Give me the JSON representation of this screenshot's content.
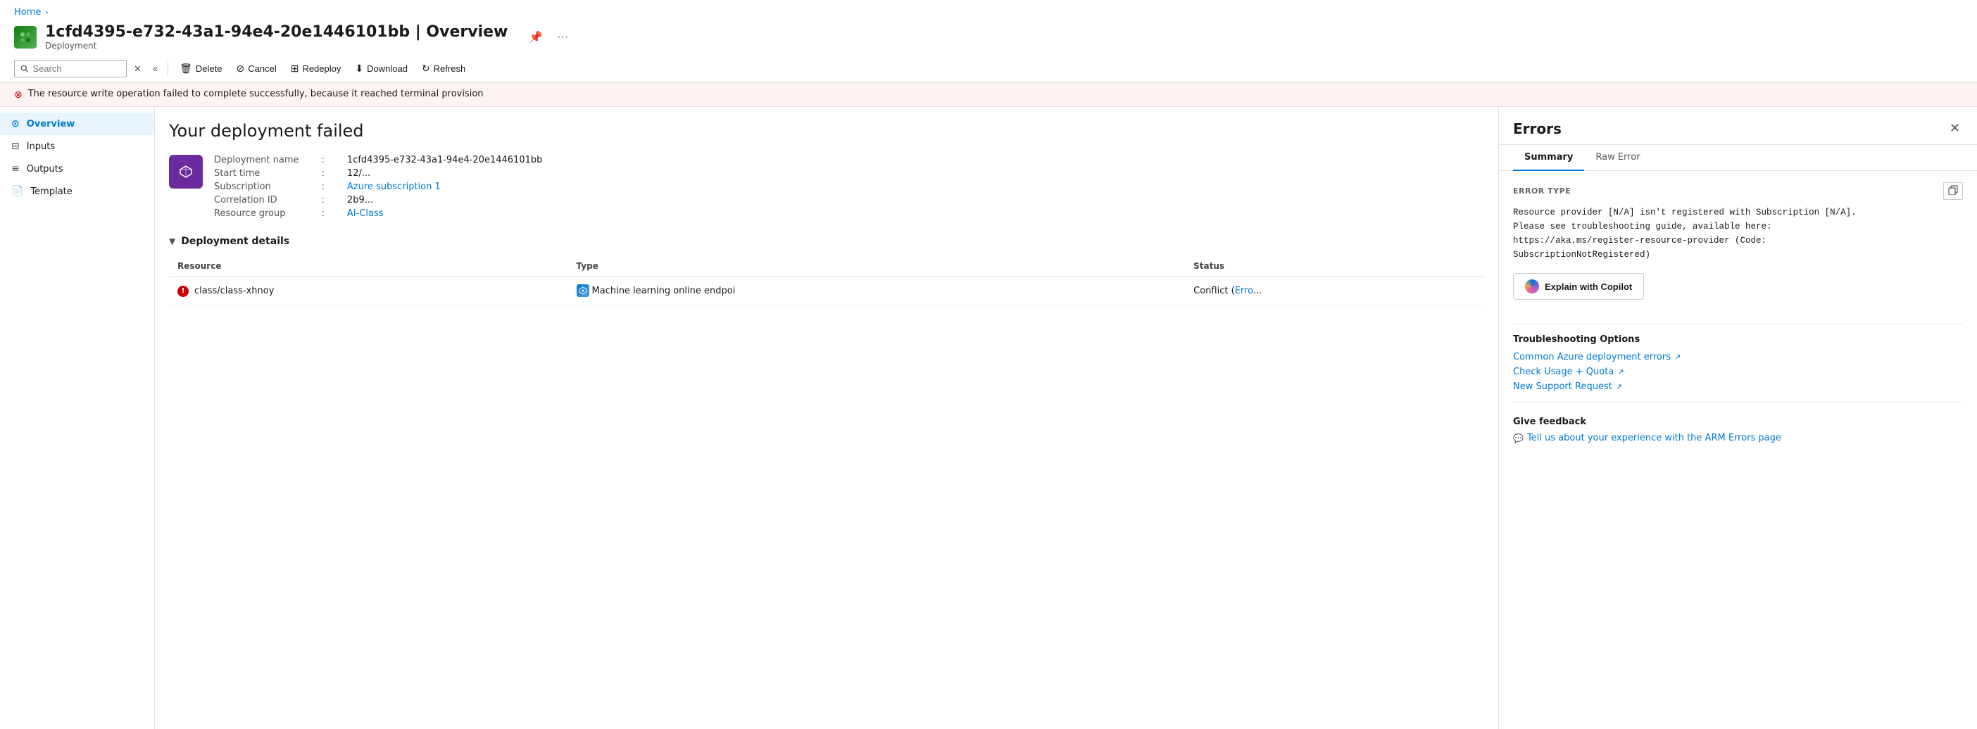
{
  "breadcrumb": {
    "home_label": "Home"
  },
  "page": {
    "icon": "🌐",
    "title": "1cfd4395-e732-43a1-94e4-20e1446101bb | Overview",
    "subtitle": "Deployment",
    "pin_icon": "📌",
    "more_icon": "···"
  },
  "toolbar": {
    "search_placeholder": "Search",
    "delete_label": "Delete",
    "cancel_label": "Cancel",
    "redeploy_label": "Redeploy",
    "download_label": "Download",
    "refresh_label": "Refresh"
  },
  "error_banner": {
    "text": "The resource write operation failed to complete successfully, because it reached terminal provision"
  },
  "sidebar": {
    "items": [
      {
        "id": "overview",
        "label": "Overview",
        "active": true
      },
      {
        "id": "inputs",
        "label": "Inputs",
        "active": false
      },
      {
        "id": "outputs",
        "label": "Outputs",
        "active": false
      },
      {
        "id": "template",
        "label": "Template",
        "active": false
      }
    ]
  },
  "main": {
    "failed_title": "Your deployment failed",
    "deployment_icon": "📦",
    "fields": {
      "deployment_name_label": "Deployment name",
      "deployment_name_value": "1cfd4395-e732-43a1-94e4-20e1446101bb",
      "subscription_label": "Subscription",
      "subscription_value": "Azure subscription 1",
      "resource_group_label": "Resource group",
      "resource_group_value": "AI-Class",
      "start_time_label": "Start time",
      "start_time_value": "12/...",
      "correlation_id_label": "Correlation ID",
      "correlation_id_value": "2b9..."
    },
    "deployment_details": {
      "section_label": "Deployment details",
      "table": {
        "columns": [
          "Resource",
          "Type",
          "Status"
        ],
        "rows": [
          {
            "resource": "class/class-xhnoy",
            "type": "Machine learning online endpoi",
            "status": "Conflict",
            "status_extra": "Erro",
            "has_error": true
          }
        ]
      }
    }
  },
  "errors_panel": {
    "title": "Errors",
    "close_icon": "✕",
    "tabs": [
      {
        "id": "summary",
        "label": "Summary",
        "active": true
      },
      {
        "id": "raw-error",
        "label": "Raw Error",
        "active": false
      }
    ],
    "error_type_label": "ERROR TYPE",
    "copy_icon": "⧉",
    "error_text": "Resource provider [N/A] isn't registered with Subscription [N/A].\nPlease see troubleshooting guide, available here:\nhttps://aka.ms/register-resource-provider (Code:\nSubscriptionNotRegistered)",
    "explain_copilot_label": "Explain with Copilot",
    "troubleshooting": {
      "title": "Troubleshooting Options",
      "links": [
        {
          "label": "Common Azure deployment errors",
          "has_ext": true
        },
        {
          "label": "Check Usage + Quota",
          "has_ext": true
        },
        {
          "label": "New Support Request",
          "has_ext": true
        }
      ]
    },
    "feedback": {
      "title": "Give feedback",
      "link_label": "Tell us about your experience with the ARM Errors page",
      "link_icon": "💬"
    }
  }
}
